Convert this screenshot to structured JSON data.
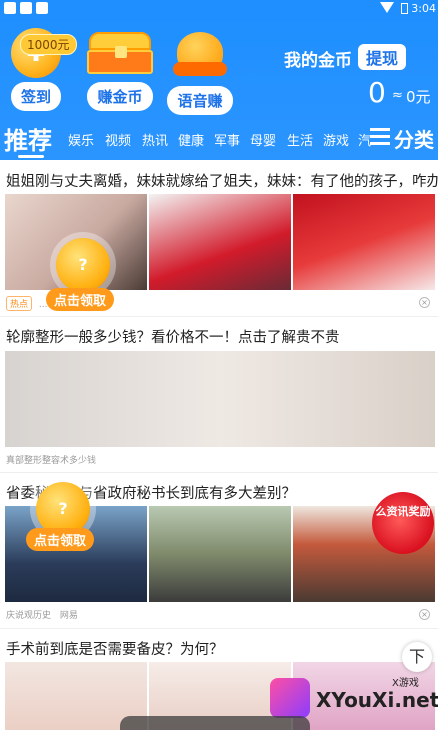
{
  "status_bar": {
    "time": "3:04"
  },
  "header": {
    "coin_badge": "1000元",
    "actions": [
      {
        "label": "签到",
        "icon": "coin-icon"
      },
      {
        "label": "赚金币",
        "icon": "treasure-chest-icon"
      },
      {
        "label": "语音赚",
        "icon": "helmet-coin-icon"
      }
    ],
    "my_coins_title": "我的金币",
    "withdraw_label": "提现",
    "coin_balance": "0",
    "approx_symbol": "≈",
    "cash_value": "0元"
  },
  "tabs": {
    "active": "推荐",
    "items": [
      "娱乐",
      "视频",
      "热讯",
      "健康",
      "军事",
      "母婴",
      "生活",
      "游戏",
      "汽"
    ],
    "category_label": "分类"
  },
  "articles": [
    {
      "title": "姐姐刚与丈夫离婚，妹妹就嫁给了姐夫，妹妹：有了他的孩子，咋办",
      "hot_badge": "热点",
      "source": "..."
    },
    {
      "title": "轮廓整形一般多少钱？看价格不一！点击了解贵不贵",
      "source": "真部整形整容术多少钱"
    },
    {
      "title": "省委秘书长与省政府秘书长到底有多大差别？",
      "source": "庆说观历史",
      "source2": "网易"
    },
    {
      "title": "手术前到底是否需要备皮？为何？"
    }
  ],
  "floating": {
    "coin_glyph": "?",
    "claim_label": "点击领取",
    "red_packet_text": "么资讯奖励"
  },
  "back_to_top": "下",
  "watermark": {
    "small": "X游戏",
    "main": "XYouXi.net"
  },
  "colors": {
    "header_blue": "#1f8fff",
    "accent_orange": "#ff9a1a",
    "pill_text_blue": "#1f73e8"
  }
}
